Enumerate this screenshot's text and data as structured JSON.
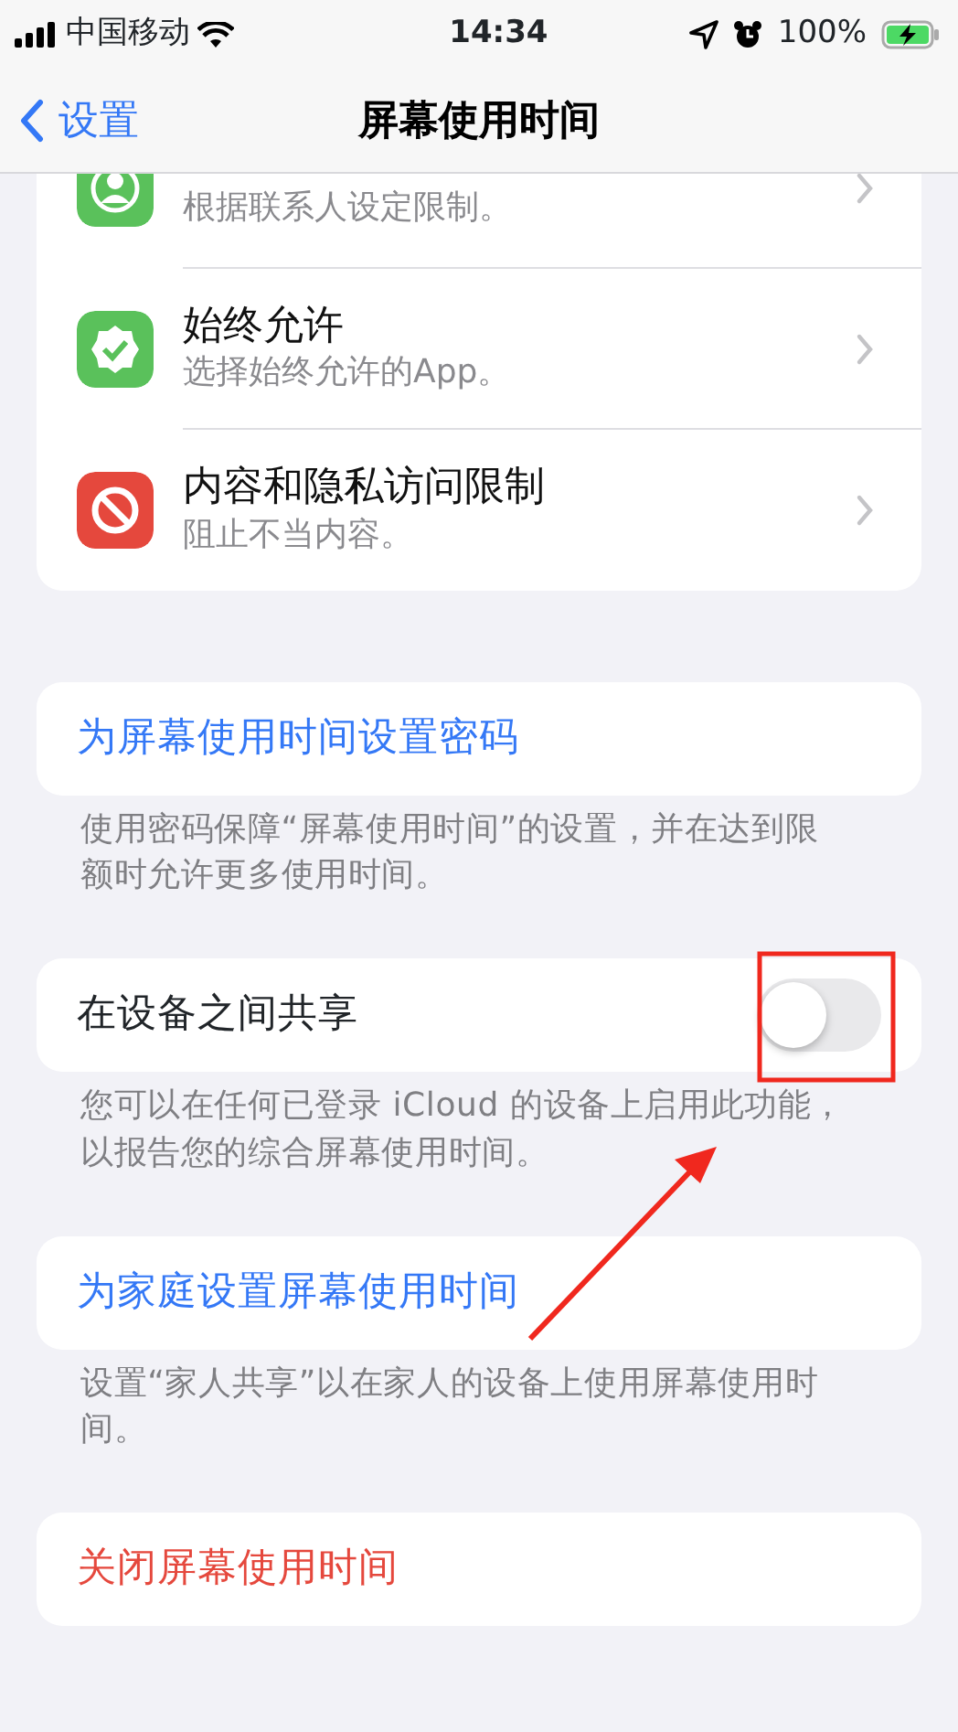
{
  "status_bar": {
    "carrier": "中国移动",
    "time": "14:34",
    "battery": "100%",
    "charging": true
  },
  "nav": {
    "back": "设置",
    "title": "屏幕使用时间"
  },
  "menu_rows": [
    {
      "color": "#5ac15b",
      "subtitle": "根据联系人设定限制。"
    },
    {
      "color": "#5ac15b",
      "title": "始终允许",
      "subtitle": "选择始终允许的App。"
    },
    {
      "color": "#e5483d",
      "title": "内容和隐私访问限制",
      "subtitle": "阻止不当内容。"
    }
  ],
  "sections": [
    {
      "kind": "link",
      "label": "为屏幕使用时间设置密码",
      "footer": "使用密码保障“屏幕使用时间”的设置，并在达到限额时允许更多使用时间。"
    },
    {
      "kind": "toggle",
      "label": "在设备之间共享",
      "on": false,
      "footer": "您可以在任何已登录 iCloud 的设备上启用此功能，以报告您的综合屏幕使用时间。"
    },
    {
      "kind": "link",
      "label": "为家庭设置屏幕使用时间",
      "footer": "设置“家人共享”以在家人的设备上使用屏幕使用时间。"
    },
    {
      "kind": "destructive",
      "label": "关闭屏幕使用时间"
    }
  ]
}
